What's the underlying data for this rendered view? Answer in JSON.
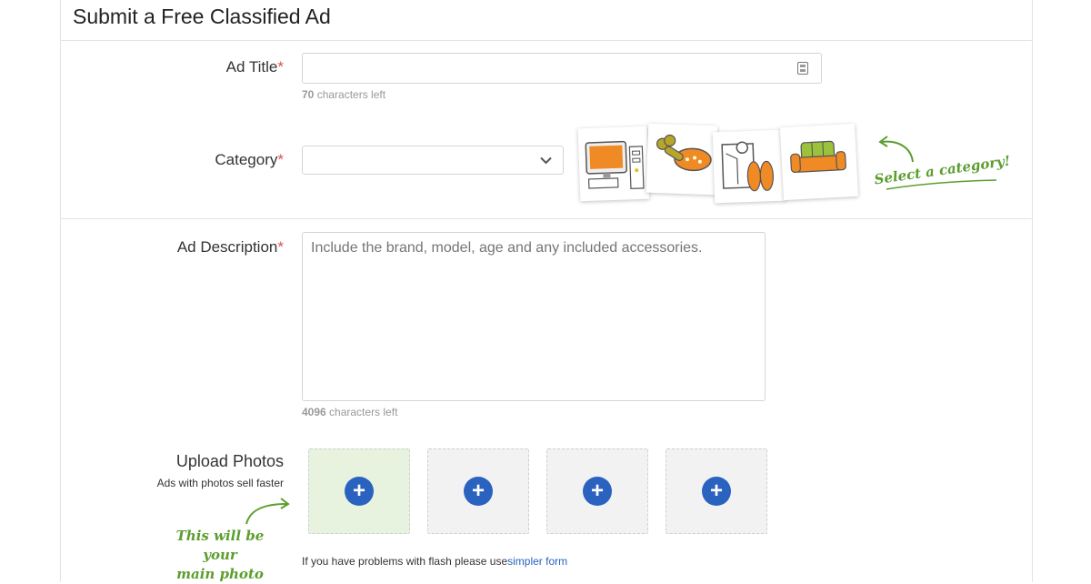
{
  "header": {
    "title": "Submit a Free Classified Ad"
  },
  "ad_title": {
    "label": "Ad Title",
    "required_mark": "*",
    "value": "",
    "counter_number": "70",
    "counter_suffix": " characters left"
  },
  "category": {
    "label": "Category",
    "required_mark": "*",
    "selected": "",
    "callout": "Select a category!",
    "category_icons": [
      "computer-icon",
      "pet-collar-icon",
      "clothing-icon",
      "sofa-icon"
    ]
  },
  "description": {
    "label": "Ad Description",
    "required_mark": "*",
    "placeholder": "Include the brand, model, age and any included accessories.",
    "counter_number": "4096",
    "counter_suffix": " characters left"
  },
  "photos": {
    "label": "Upload Photos",
    "sublabel": "Ads with photos sell faster",
    "main_note_line1": "This will be your",
    "main_note_line2": "main photo",
    "slots": [
      "+",
      "+",
      "+",
      "+"
    ],
    "flash_text": "If you have problems with flash please use",
    "flash_link": "simpler form"
  },
  "colors": {
    "accent_blue": "#2a62c0",
    "required_red": "#d9534f",
    "callout_green": "#5b9e2e",
    "main_slot_bg": "#e8f3df",
    "orange": "#f08a24"
  }
}
